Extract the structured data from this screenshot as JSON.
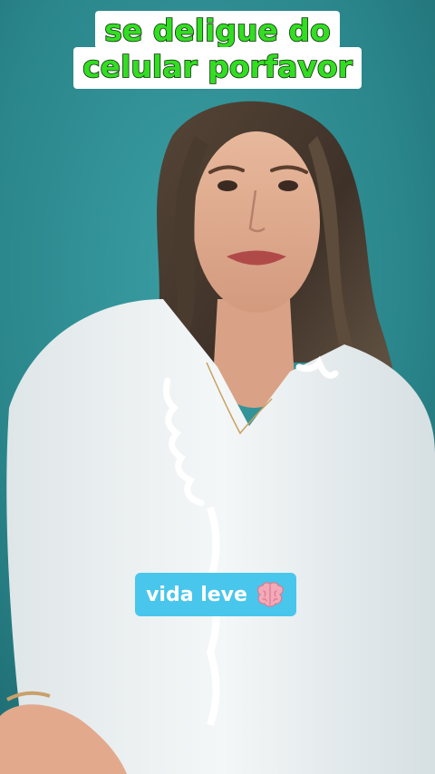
{
  "caption": {
    "line1": "se deligue do",
    "line2": "celular porfavor"
  },
  "sticker": {
    "text": "vida leve",
    "icon": "brain-icon"
  },
  "colors": {
    "background": "#2c8a8f",
    "caption_text": "#33dd22",
    "caption_bg": "#ffffff",
    "sticker_bg": "#49c6ec"
  }
}
